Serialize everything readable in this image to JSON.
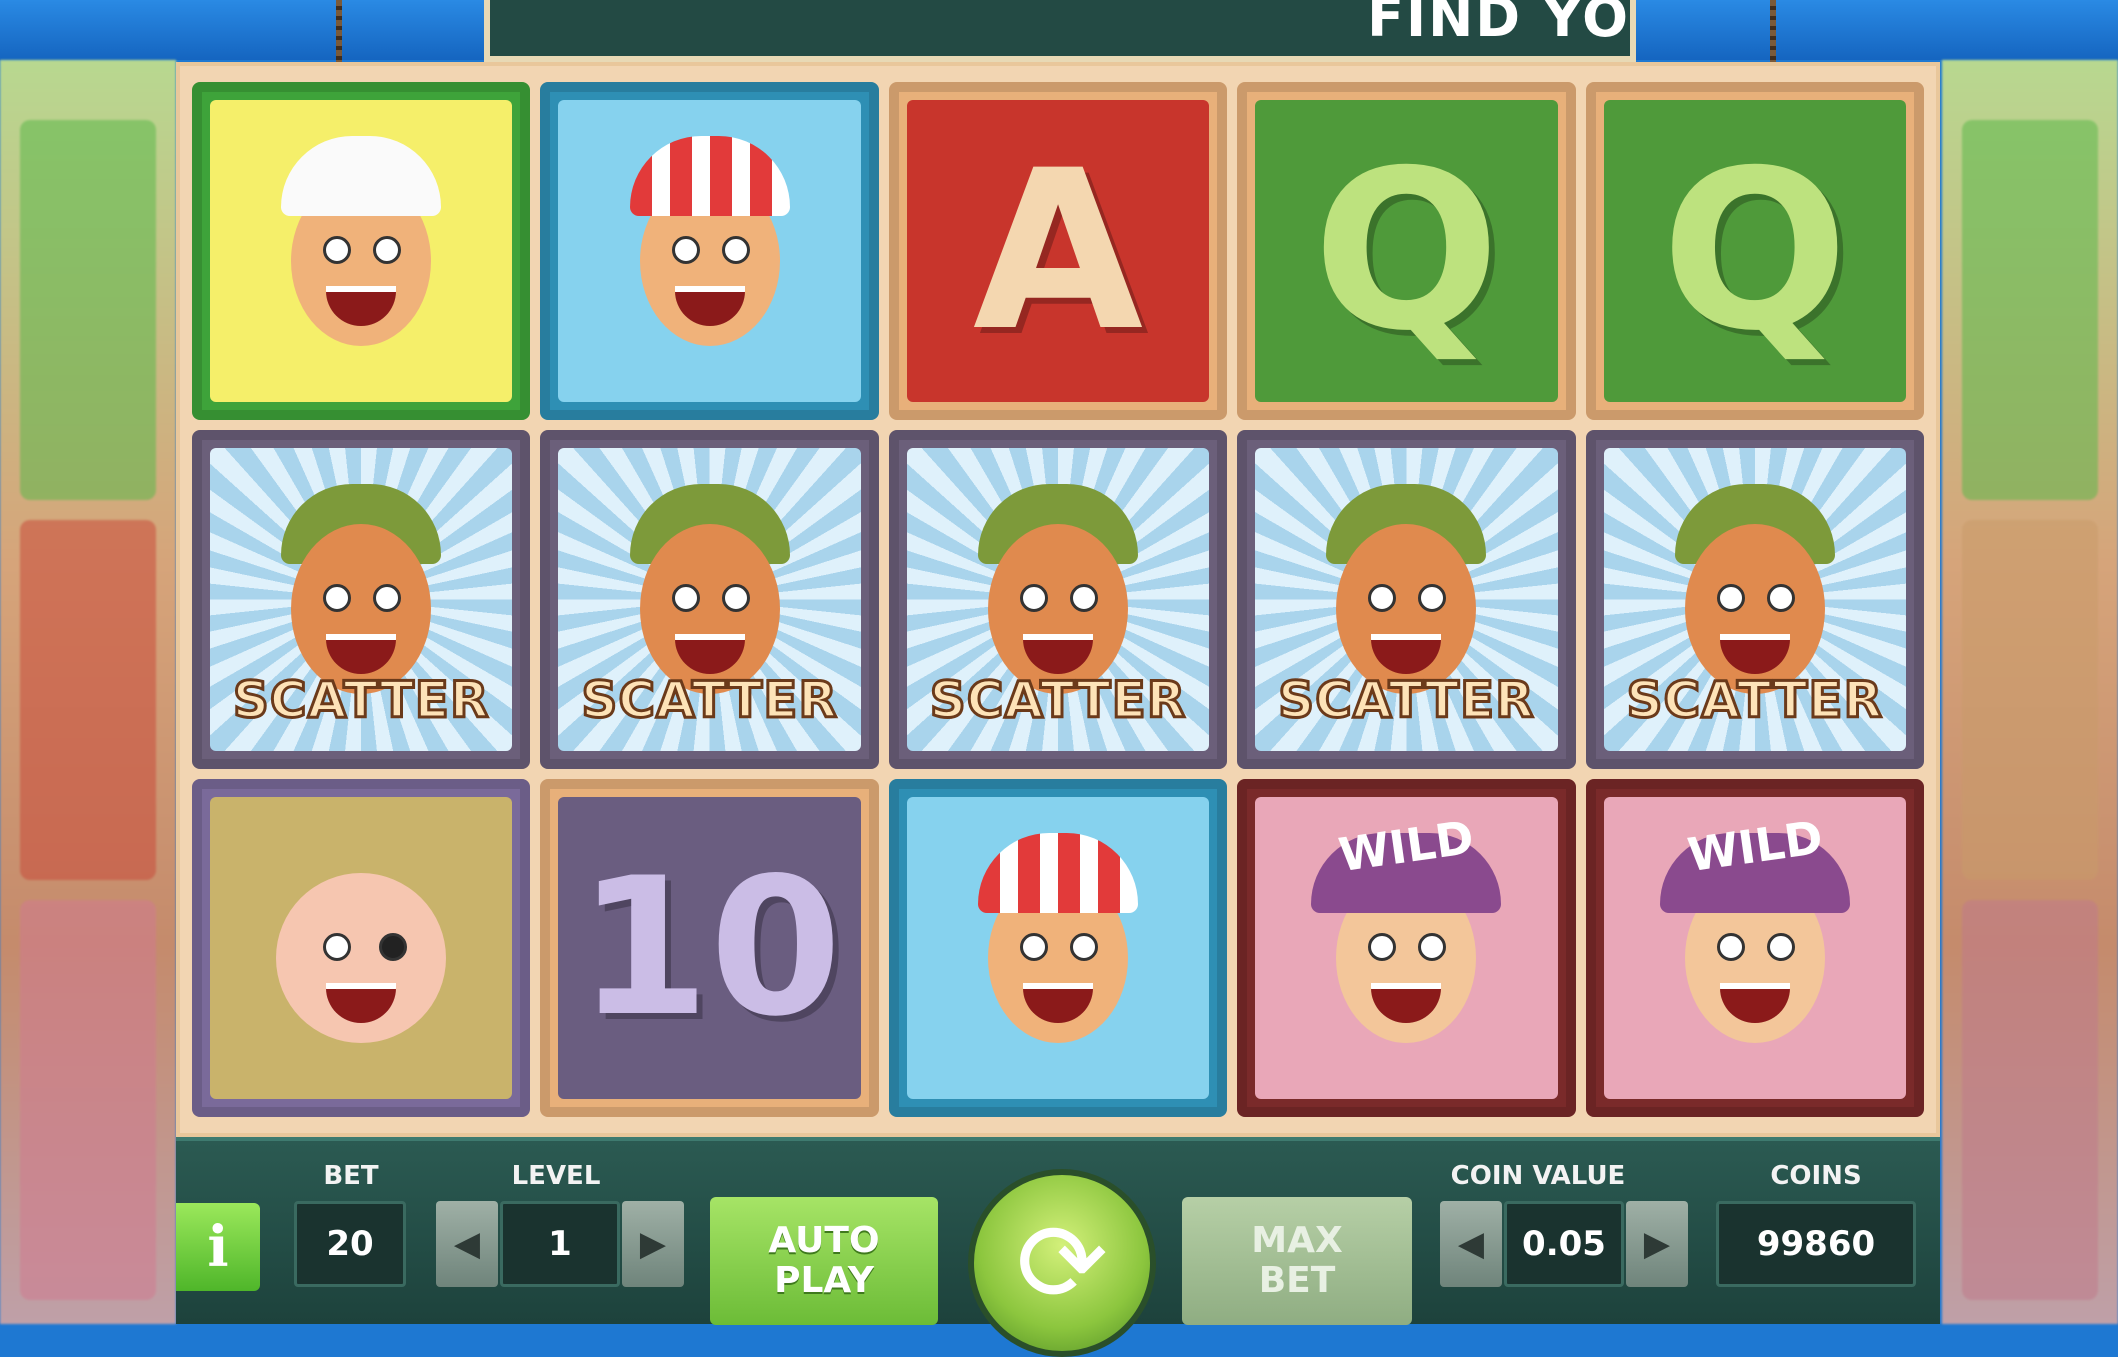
{
  "banner": {
    "text": "FIND YO"
  },
  "reels": [
    [
      {
        "symbol": "nurse-kid",
        "label": ""
      },
      {
        "symbol": "scatter-croc-kid",
        "label": "SCATTER"
      },
      {
        "symbol": "eyepatch-kid",
        "label": ""
      }
    ],
    [
      {
        "symbol": "duck-hat-kid",
        "label": ""
      },
      {
        "symbol": "scatter-croc-kid",
        "label": "SCATTER"
      },
      {
        "symbol": "ten",
        "label": "10"
      }
    ],
    [
      {
        "symbol": "ace",
        "label": "A"
      },
      {
        "symbol": "scatter-croc-kid",
        "label": "SCATTER"
      },
      {
        "symbol": "duck-hat-kid",
        "label": ""
      }
    ],
    [
      {
        "symbol": "queen",
        "label": "Q"
      },
      {
        "symbol": "scatter-croc-kid",
        "label": "SCATTER"
      },
      {
        "symbol": "wild-pirate",
        "label": "WILD"
      }
    ],
    [
      {
        "symbol": "queen",
        "label": "Q"
      },
      {
        "symbol": "scatter-croc-kid",
        "label": "SCATTER"
      },
      {
        "symbol": "wild-pirate",
        "label": "WILD"
      }
    ]
  ],
  "controls": {
    "info_label": "i",
    "bet_label": "BET",
    "bet_value": "20",
    "level_label": "LEVEL",
    "level_value": "1",
    "autoplay_label_1": "AUTO",
    "autoplay_label_2": "PLAY",
    "maxbet_label_1": "MAX",
    "maxbet_label_2": "BET",
    "coin_value_label": "COIN VALUE",
    "coin_value": "0.05",
    "coins_label": "COINS",
    "coins_value": "99860"
  },
  "colors": {
    "panel": "#1d423c",
    "spin_button": "#8cc63e",
    "autoplay_button": "#8ed24a",
    "maxbet_button": "#a9c59a"
  }
}
